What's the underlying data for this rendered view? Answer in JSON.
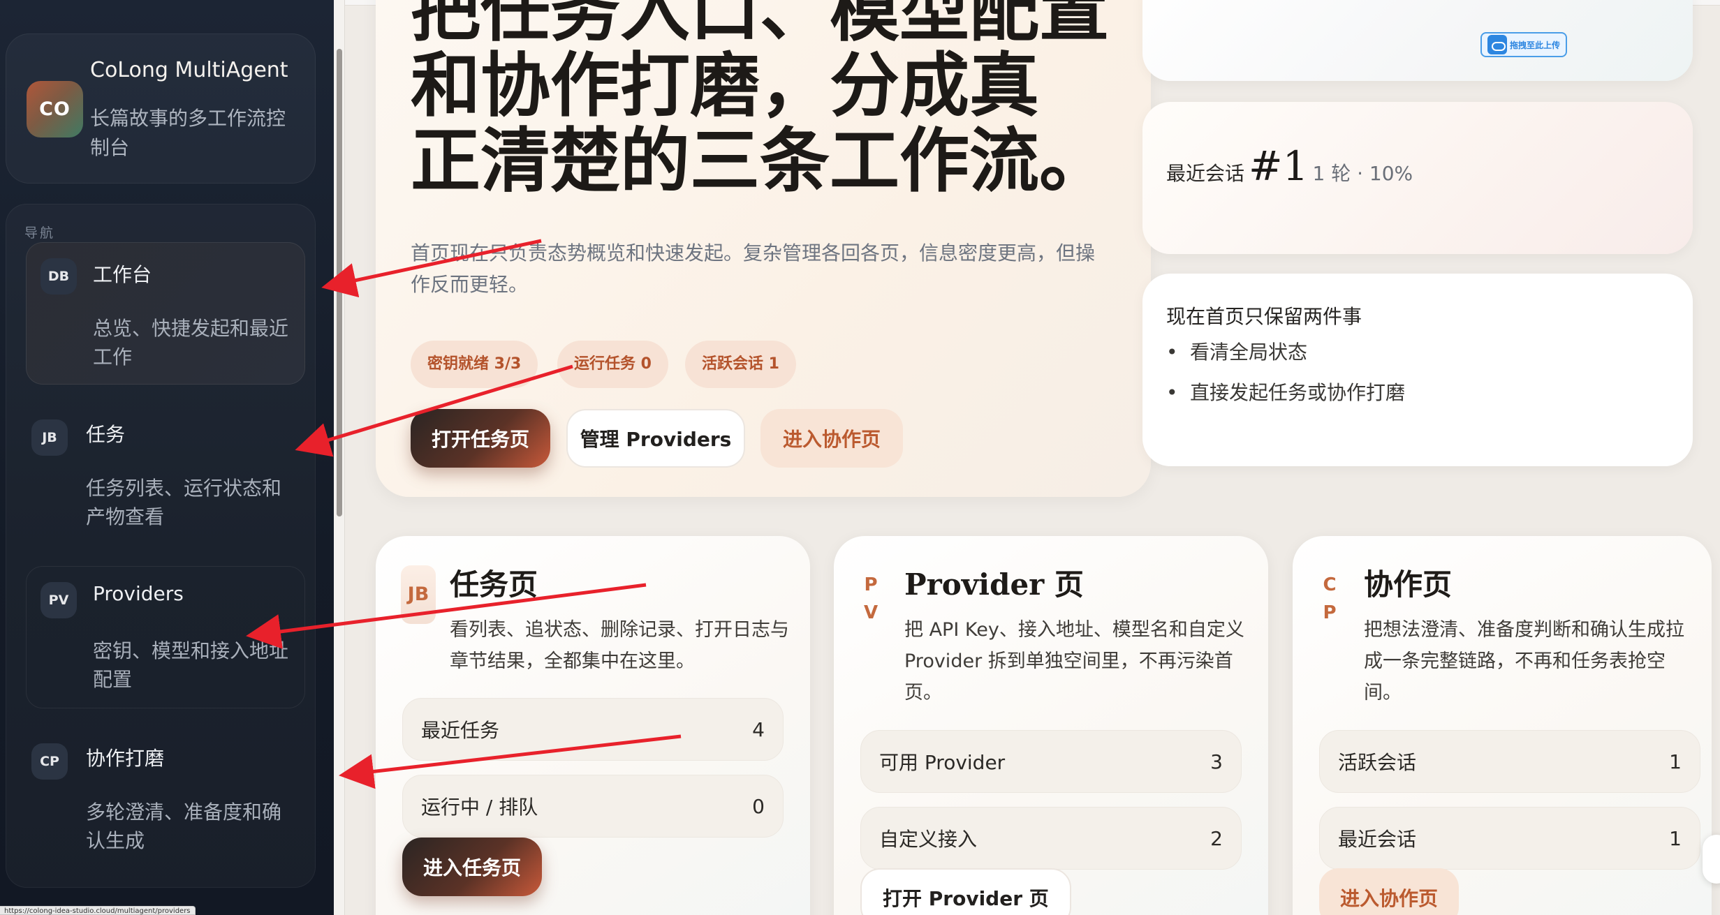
{
  "brand": {
    "logo_text": "CO",
    "name": "CoLong MultiAgent",
    "subtitle": "长篇故事的多工作流控制台"
  },
  "nav": {
    "heading": "导航",
    "items": [
      {
        "badge": "DB",
        "title": "工作台",
        "desc": "总览、快捷发起和最近工作",
        "active": true
      },
      {
        "badge": "JB",
        "title": "任务",
        "desc": "任务列表、运行状态和产物查看",
        "active": false
      },
      {
        "badge": "PV",
        "title": "Providers",
        "desc": "密钥、模型和接入地址配置",
        "active": false
      },
      {
        "badge": "CP",
        "title": "协作打磨",
        "desc": "多轮澄清、准备度和确认生成",
        "active": false
      }
    ]
  },
  "status_url": "https://colong-idea-studio.cloud/multiagent/providers",
  "hero": {
    "title_lines": [
      "把任务入口、模型配置",
      "和协作打磨，分成真",
      "正清楚的三条工作流。"
    ],
    "description": "首页现在只负责态势概览和快速发起。复杂管理各回各页，信息密度更高，但操作反而更轻。",
    "pills": [
      "密钥就绪 3/3",
      "运行任务 0",
      "活跃会话 1"
    ],
    "buttons": {
      "open_tasks": "打开任务页",
      "manage_providers": "管理 Providers",
      "enter_collab": "进入协作页"
    }
  },
  "upload_chip": "拖拽至此上传",
  "recent_session": {
    "label": "最近会话",
    "number": "#1",
    "meta": "1 轮 · 10%"
  },
  "homepage_keep": {
    "title": "现在首页只保留两件事",
    "items": [
      "看清全局状态",
      "直接发起任务或协作打磨"
    ]
  },
  "cards": {
    "tasks": {
      "badge": "JB",
      "title": "任务页",
      "desc": "看列表、追状态、删除记录、打开日志与章节结果，全都集中在这里。",
      "stats": [
        {
          "label": "最近任务",
          "value": "4"
        },
        {
          "label": "运行中 / 排队",
          "value": "0"
        }
      ],
      "button": "进入任务页"
    },
    "providers": {
      "badge": "PV",
      "title": "Provider 页",
      "desc": "把 API Key、接入地址、模型名和自定义 Provider 拆到单独空间里，不再污染首页。",
      "stats": [
        {
          "label": "可用 Provider",
          "value": "3"
        },
        {
          "label": "自定义接入",
          "value": "2"
        }
      ],
      "button": "打开 Provider 页"
    },
    "collab": {
      "badge": "CP",
      "title": "协作页",
      "desc": "把想法澄清、准备度判断和确认生成拉成一条完整链路，不再和任务表抢空间。",
      "stats": [
        {
          "label": "活跃会话",
          "value": "1"
        },
        {
          "label": "最近会话",
          "value": "1"
        }
      ],
      "button": "进入协作页"
    }
  },
  "colors": {
    "sidebar_bg": "#1a2230",
    "accent": "#c8593a",
    "pill_bg": "#f7e2d5",
    "annotation_arrow": "#e8212b"
  }
}
